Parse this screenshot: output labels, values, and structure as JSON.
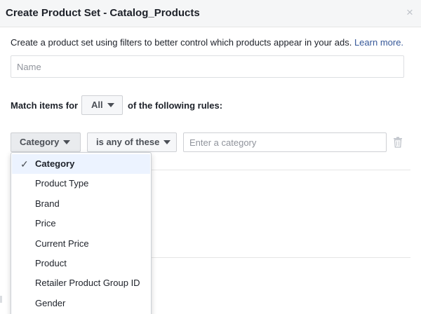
{
  "dialog": {
    "title": "Create Product Set - Catalog_Products",
    "close_glyph": "×"
  },
  "intro": {
    "text": "Create a product set using filters to better control which products appear in your ads.",
    "link_text": "Learn more."
  },
  "name_field": {
    "placeholder": "Name",
    "value": ""
  },
  "match": {
    "prefix": "Match items for",
    "selected": "All",
    "suffix": "of the following rules:"
  },
  "rule": {
    "field": "Category",
    "operator": "is any of these",
    "value_placeholder": "Enter a category",
    "value": ""
  },
  "dropdown": {
    "selected_index": 0,
    "check_glyph": "✓",
    "items": [
      "Category",
      "Product Type",
      "Brand",
      "Price",
      "Current Price",
      "Product",
      "Retailer Product Group ID",
      "Gender"
    ]
  },
  "colors": {
    "link": "#365899",
    "header_bg": "#f5f6f7",
    "selected_item_bg": "#ecf3ff"
  }
}
